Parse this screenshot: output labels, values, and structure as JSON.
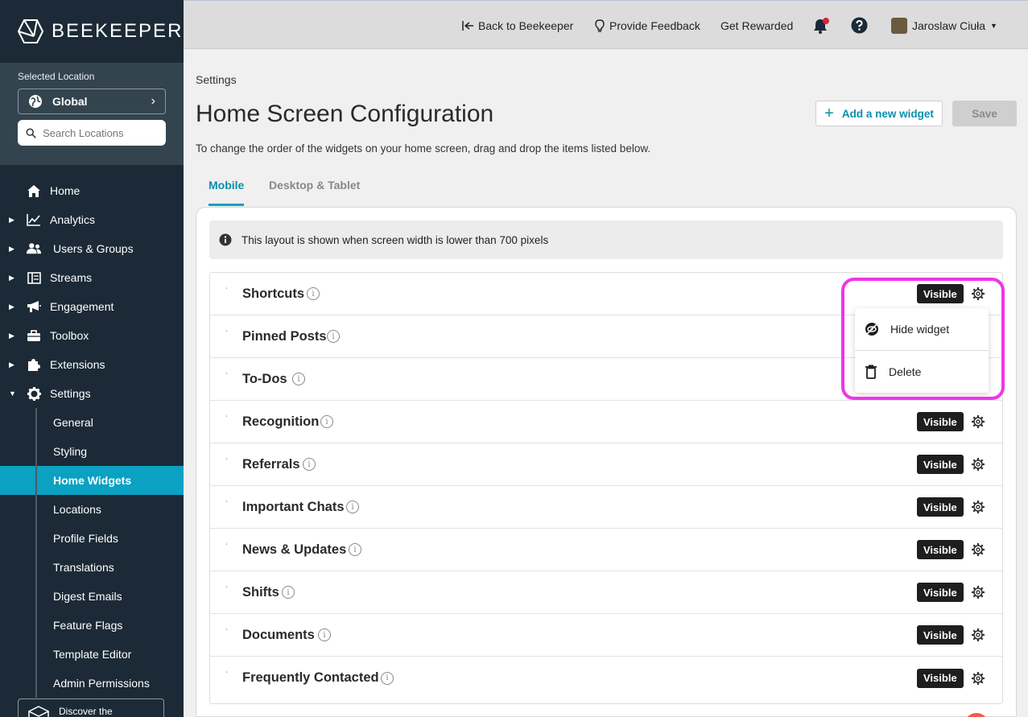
{
  "brand": {
    "name": "BEEKEEPER"
  },
  "location": {
    "label": "Selected Location",
    "selected": "Global",
    "search_placeholder": "Search Locations"
  },
  "nav": [
    {
      "label": "Home",
      "icon": "home-icon"
    },
    {
      "label": "Analytics",
      "icon": "chart-icon"
    },
    {
      "label": "Users & Groups",
      "icon": "users-icon"
    },
    {
      "label": "Streams",
      "icon": "streams-icon"
    },
    {
      "label": "Engagement",
      "icon": "megaphone-icon"
    },
    {
      "label": "Toolbox",
      "icon": "toolbox-icon"
    },
    {
      "label": "Extensions",
      "icon": "puzzle-icon"
    },
    {
      "label": "Settings",
      "icon": "gear-icon"
    }
  ],
  "settings_sub": [
    "General",
    "Styling",
    "Home Widgets",
    "Locations",
    "Profile Fields",
    "Translations",
    "Digest Emails",
    "Feature Flags",
    "Template Editor",
    "Admin Permissions"
  ],
  "discover": {
    "label": "Discover the"
  },
  "topbar": {
    "back": "Back to Beekeeper",
    "feedback": "Provide Feedback",
    "rewarded": "Get Rewarded",
    "user": "Jaroslaw Ciuła"
  },
  "page": {
    "breadcrumb": "Settings",
    "title": "Home Screen Configuration",
    "subtitle": "To change the order of the widgets on your home screen, drag and drop the items listed below.",
    "add_widget": "Add a new widget",
    "save": "Save",
    "tabs": [
      "Mobile",
      "Desktop & Tablet"
    ],
    "info": "This layout is shown when screen width is lower than 700 pixels"
  },
  "widgets": [
    {
      "label": "Shortcuts",
      "status": "Visible"
    },
    {
      "label": "Pinned Posts",
      "status": ""
    },
    {
      "label": "To-Dos",
      "status": ""
    },
    {
      "label": "Recognition",
      "status": "Visible"
    },
    {
      "label": "Referrals",
      "status": "Visible"
    },
    {
      "label": "Important Chats",
      "status": "Visible"
    },
    {
      "label": "News & Updates",
      "status": "Visible"
    },
    {
      "label": "Shifts",
      "status": "Visible"
    },
    {
      "label": "Documents",
      "status": "Visible"
    },
    {
      "label": "Frequently Contacted",
      "status": "Visible"
    }
  ],
  "menu": {
    "hide": "Hide widget",
    "delete": "Delete"
  },
  "colors": {
    "accent": "#0aa1c2",
    "sidebar": "#1b2a36",
    "highlight": "#ee36e6"
  }
}
